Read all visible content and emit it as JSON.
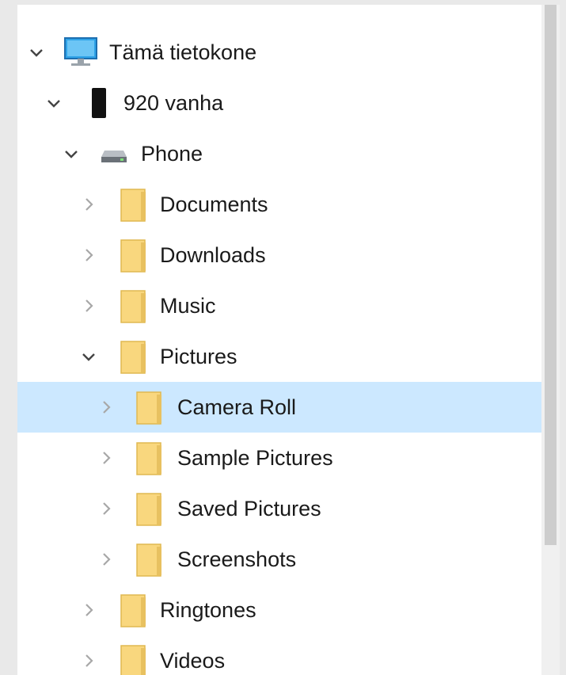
{
  "tree": {
    "root": {
      "label": "Tämä tietokone",
      "icon": "monitor-icon",
      "expanded": true
    },
    "device": {
      "label": "920 vanha",
      "icon": "phone-icon",
      "expanded": true
    },
    "storage": {
      "label": "Phone",
      "icon": "drive-icon",
      "expanded": true
    },
    "folders": [
      {
        "label": "Documents",
        "icon": "folder-icon",
        "expanded": false
      },
      {
        "label": "Downloads",
        "icon": "folder-icon",
        "expanded": false
      },
      {
        "label": "Music",
        "icon": "folder-icon",
        "expanded": false
      },
      {
        "label": "Pictures",
        "icon": "folder-icon",
        "expanded": true
      }
    ],
    "pictures_children": [
      {
        "label": "Camera Roll",
        "icon": "folder-icon",
        "expanded": false,
        "selected": true
      },
      {
        "label": "Sample Pictures",
        "icon": "folder-icon",
        "expanded": false,
        "selected": false
      },
      {
        "label": "Saved Pictures",
        "icon": "folder-icon",
        "expanded": false,
        "selected": false
      },
      {
        "label": "Screenshots",
        "icon": "folder-icon",
        "expanded": false,
        "selected": false
      }
    ],
    "more_folders": [
      {
        "label": "Ringtones",
        "icon": "folder-icon",
        "expanded": false
      },
      {
        "label": "Videos",
        "icon": "folder-icon",
        "expanded": false
      }
    ]
  },
  "colors": {
    "selection": "#cce8ff",
    "folder": "#f9d77e",
    "panel": "#ffffff",
    "background": "#e9e9e9"
  }
}
